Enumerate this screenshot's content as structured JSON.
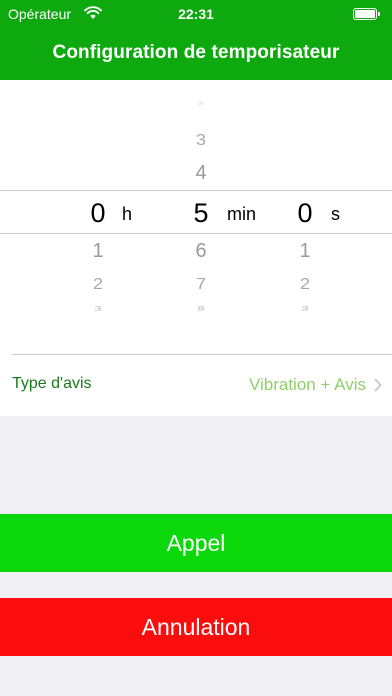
{
  "status_bar": {
    "carrier": "Opérateur",
    "time": "22:31",
    "battery_level": 1.0
  },
  "nav": {
    "title": "Configuration de temporisateur"
  },
  "picker": {
    "hours": {
      "selected": "0",
      "unit": "h",
      "below": [
        "1",
        "2",
        "3"
      ]
    },
    "minutes": {
      "selected": "5",
      "unit": "min",
      "above": [
        "2",
        "3",
        "4"
      ],
      "below": [
        "6",
        "7",
        "8"
      ]
    },
    "seconds": {
      "selected": "0",
      "unit": "s",
      "below": [
        "1",
        "2",
        "3"
      ]
    }
  },
  "notification": {
    "label": "Type d'avis",
    "value": "Vibration + Avis"
  },
  "buttons": {
    "call": "Appel",
    "cancel": "Annulation"
  },
  "colors": {
    "nav_green": "#0da90f",
    "call_green": "#0bd80b",
    "cancel_red": "#fc0d0d",
    "label_green": "#1a7a1a",
    "value_green": "#8fcf6a",
    "background": "#efeff4"
  },
  "icons": {
    "wifi": "wifi-icon",
    "battery": "battery-icon",
    "chevron": "chevron-right-icon"
  }
}
